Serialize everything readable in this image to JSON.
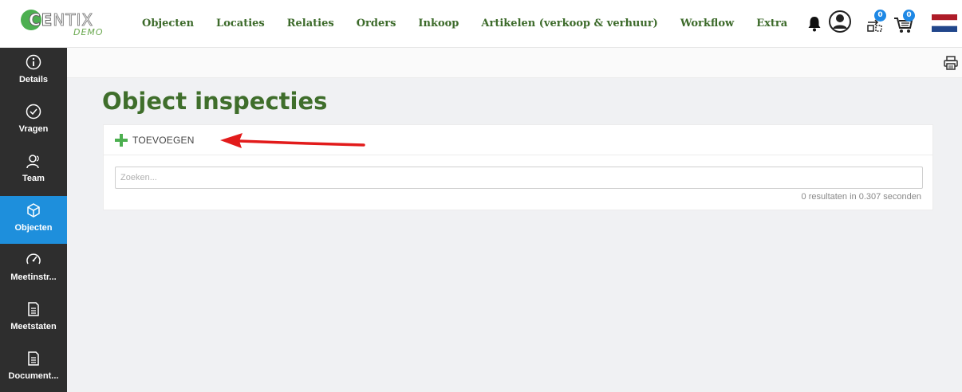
{
  "brand": {
    "name_bold": "CE",
    "name_light": "NTIX",
    "tagline": "DEMO",
    "accent": "#4caf50"
  },
  "nav": {
    "items": [
      {
        "label": "Objecten"
      },
      {
        "label": "Locaties"
      },
      {
        "label": "Relaties"
      },
      {
        "label": "Orders"
      },
      {
        "label": "Inkoop"
      },
      {
        "label": "Artikelen (verkoop & verhuur)"
      },
      {
        "label": "Workflow"
      },
      {
        "label": "Extra"
      }
    ],
    "color": "#3c6a2a"
  },
  "top_icons": {
    "notifications": "bell-icon",
    "account": "user-circle-icon",
    "compare": {
      "icon": "compare-icon",
      "count": "0"
    },
    "cart": {
      "icon": "cart-icon",
      "count": "0"
    },
    "language": "dutch-flag-icon"
  },
  "sidebar": {
    "items": [
      {
        "label": "Details",
        "icon": "info-icon",
        "active": false
      },
      {
        "label": "Vragen",
        "icon": "check-circle-icon",
        "active": false
      },
      {
        "label": "Team",
        "icon": "team-icon",
        "active": false
      },
      {
        "label": "Objecten",
        "icon": "cube-icon",
        "active": true
      },
      {
        "label": "Meetinstr...",
        "icon": "gauge-icon",
        "active": false
      },
      {
        "label": "Meetstaten",
        "icon": "document-icon",
        "active": false
      },
      {
        "label": "Document...",
        "icon": "document-icon",
        "active": false
      }
    ],
    "active_color": "#1e8fdc"
  },
  "toolbar": {
    "print": "print-icon"
  },
  "page": {
    "title": "Object inspecties",
    "add_label": "TOEVOEGEN",
    "search_placeholder": "Zoeken...",
    "search_value": "",
    "results_text": "0 resultaten in 0.307 seconden"
  }
}
